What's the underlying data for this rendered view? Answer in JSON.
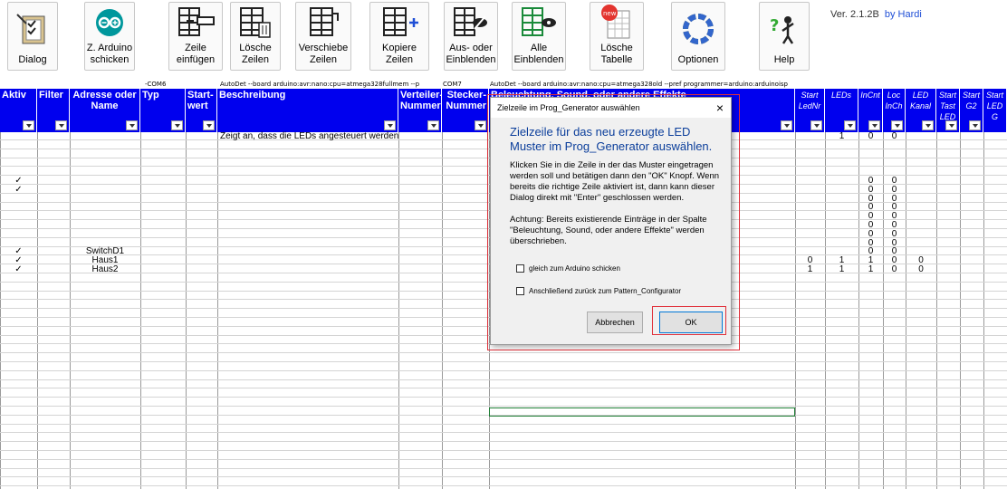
{
  "ribbon": {
    "buttons": [
      {
        "label": "Dialog",
        "icon": "checklist-icon"
      },
      {
        "label": "Z. Arduino schicken",
        "icon": "arduino-icon"
      },
      {
        "label": "Zeile einfügen",
        "icon": "insert-row-icon"
      },
      {
        "label": "Lösche Zeilen",
        "icon": "delete-rows-icon"
      },
      {
        "label": "Verschiebe Zeilen",
        "icon": "move-rows-icon"
      },
      {
        "label": "Kopiere Zeilen",
        "icon": "copy-rows-icon"
      },
      {
        "label": "Aus- oder Einblenden",
        "icon": "hide-show-icon"
      },
      {
        "label": "Alle Einblenden",
        "icon": "show-all-icon"
      },
      {
        "label": "Lösche Tabelle",
        "icon": "new-table-icon"
      },
      {
        "label": "Optionen",
        "icon": "options-ring-icon"
      },
      {
        "label": "Help",
        "icon": "help-icon"
      }
    ],
    "version": "Ver. 2.1.2B",
    "author": "by Hardi"
  },
  "infoline": {
    "com6": "-COM6",
    "autodet1": "AutoDet --board arduino:avr:nano:cpu=atmega328fullmem --p",
    "com7": "COM7",
    "autodet2": "AutoDet --board arduino:avr:nano:cpu=atmega328old --pref programmer=arduino:arduinoisp"
  },
  "headers": {
    "aktiv": "Aktiv",
    "filter": "Filter",
    "adresse": "Adresse oder Name",
    "typ": "Typ",
    "startwert": "Start- wert",
    "beschreibung": "Beschreibung",
    "verteiler": "Verteiler- Nummer",
    "stecker": "Stecker- Nummer",
    "beleuchtung": "Beleuchtung, Sound, oder andere Effekte",
    "startledn": "Start LedNr",
    "leds": "LEDs",
    "incnt": "InCnt",
    "locinch": "Loc InCh",
    "ledkanal": "LED Kanal",
    "starttast": "Start Tast LED",
    "startg2": "Start G2",
    "startledg": "Start LED G"
  },
  "rows": [
    {
      "aktiv": "",
      "name": "",
      "desc": "Zeigt an, dass die LEDs angesteuert werden",
      "lednr": "",
      "leds": "1",
      "incnt": "0",
      "locinch": "0",
      "kanal": ""
    },
    {
      "aktiv": "",
      "name": "",
      "desc": "",
      "lednr": "",
      "leds": "",
      "incnt": "",
      "locinch": "",
      "kanal": ""
    },
    {
      "aktiv": "",
      "name": "",
      "desc": "",
      "lednr": "",
      "leds": "",
      "incnt": "",
      "locinch": "",
      "kanal": ""
    },
    {
      "aktiv": "",
      "name": "",
      "desc": "",
      "lednr": "",
      "leds": "",
      "incnt": "",
      "locinch": "",
      "kanal": ""
    },
    {
      "aktiv": "",
      "name": "",
      "desc": "",
      "lednr": "",
      "leds": "",
      "incnt": "",
      "locinch": "",
      "kanal": ""
    },
    {
      "aktiv": "✓",
      "name": "",
      "desc": "",
      "lednr": "",
      "leds": "",
      "incnt": "0",
      "locinch": "0",
      "kanal": ""
    },
    {
      "aktiv": "✓",
      "name": "",
      "desc": "",
      "lednr": "",
      "leds": "",
      "incnt": "0",
      "locinch": "0",
      "kanal": ""
    },
    {
      "aktiv": "",
      "name": "",
      "desc": "",
      "lednr": "",
      "leds": "",
      "incnt": "0",
      "locinch": "0",
      "kanal": ""
    },
    {
      "aktiv": "",
      "name": "",
      "desc": "",
      "lednr": "",
      "leds": "",
      "incnt": "0",
      "locinch": "0",
      "kanal": ""
    },
    {
      "aktiv": "",
      "name": "",
      "desc": "",
      "lednr": "",
      "leds": "",
      "incnt": "0",
      "locinch": "0",
      "kanal": ""
    },
    {
      "aktiv": "",
      "name": "",
      "desc": "",
      "lednr": "",
      "leds": "",
      "incnt": "0",
      "locinch": "0",
      "kanal": ""
    },
    {
      "aktiv": "",
      "name": "",
      "desc": "",
      "lednr": "",
      "leds": "",
      "incnt": "0",
      "locinch": "0",
      "kanal": ""
    },
    {
      "aktiv": "",
      "name": "",
      "desc": "",
      "lednr": "",
      "leds": "",
      "incnt": "0",
      "locinch": "0",
      "kanal": ""
    },
    {
      "aktiv": "✓",
      "name": "SwitchD1",
      "desc": "",
      "lednr": "",
      "leds": "",
      "incnt": "0",
      "locinch": "0",
      "kanal": ""
    },
    {
      "aktiv": "✓",
      "name": "Haus1",
      "desc": "",
      "lednr": "0",
      "leds": "1",
      "incnt": "1",
      "locinch": "0",
      "kanal": "0"
    },
    {
      "aktiv": "✓",
      "name": "Haus2",
      "desc": "",
      "lednr": "1",
      "leds": "1",
      "incnt": "1",
      "locinch": "0",
      "kanal": "0"
    }
  ],
  "dialog": {
    "title": "Zielzeile im Prog_Generator auswählen",
    "heading": "Zielzeile für das neu erzeugte LED Muster im Prog_Generator auswählen.",
    "para1": "Klicken Sie in die Zeile in der das Muster eingetragen werden soll und betätigen dann den \"OK\" Knopf. Wenn bereits die richtige Zeile aktiviert ist, dann kann dieser Dialog direkt mit \"Enter\" geschlossen werden.",
    "para2": "Achtung: Bereits existierende Einträge in der Spalte \"Beleuchtung, Sound, oder andere Effekte\" werden überschrieben.",
    "check1": "gleich zum Arduino schicken",
    "check2": "Anschließend zurück zum Pattern_Configurator",
    "cancel": "Abbrechen",
    "ok": "OK"
  }
}
